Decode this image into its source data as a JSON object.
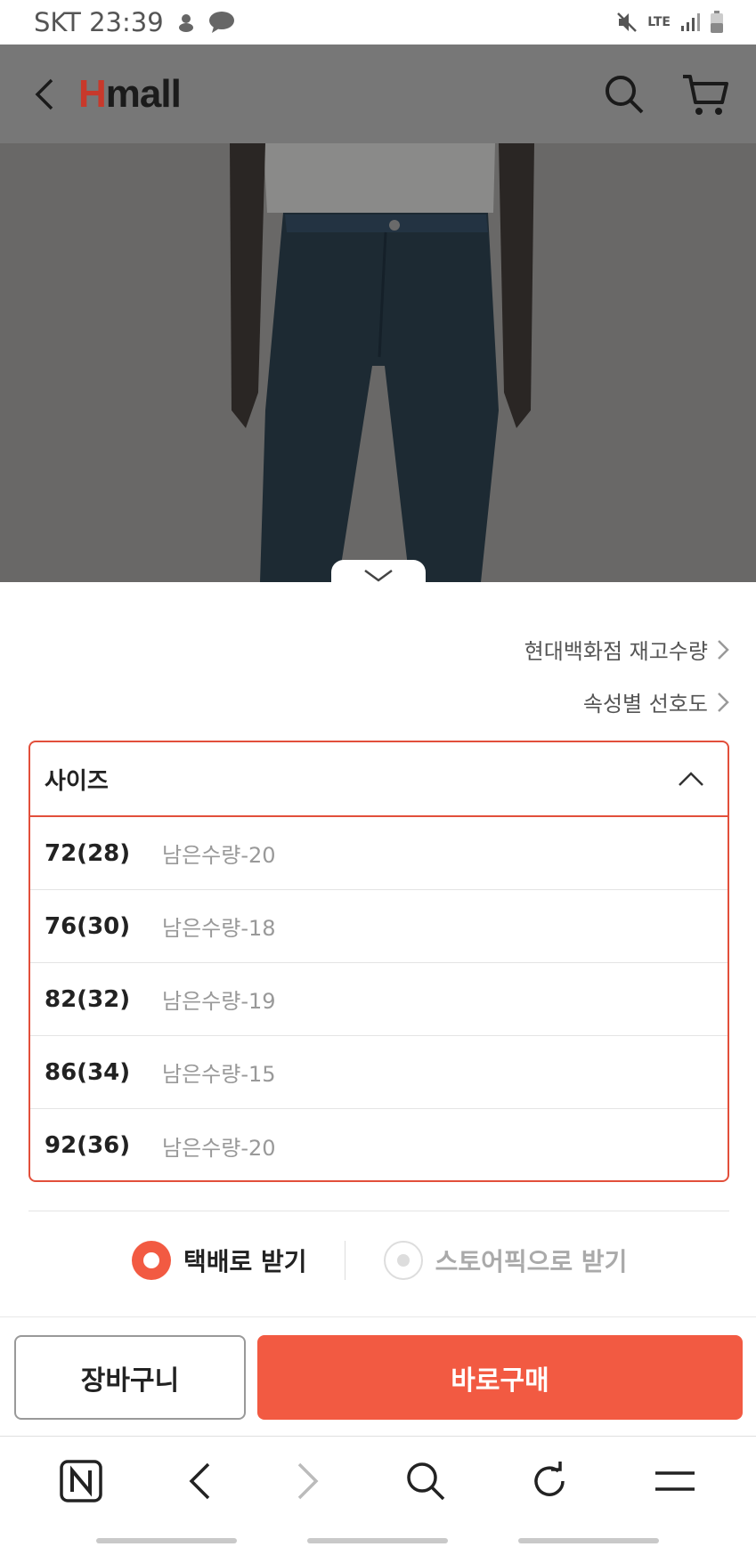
{
  "status_bar": {
    "carrier_time": "SKT 23:39",
    "network": "LTE"
  },
  "app_bar": {
    "logo_h": "H",
    "logo_rest": "mall"
  },
  "links": {
    "stock": "현대백화점 재고수량",
    "preference": "속성별 선호도"
  },
  "size_dropdown": {
    "label": "사이즈",
    "options": [
      {
        "size": "72(28)",
        "stock": "남은수량-20"
      },
      {
        "size": "76(30)",
        "stock": "남은수량-18"
      },
      {
        "size": "82(32)",
        "stock": "남은수량-19"
      },
      {
        "size": "86(34)",
        "stock": "남은수량-15"
      },
      {
        "size": "92(36)",
        "stock": "남은수량-20"
      }
    ]
  },
  "delivery": {
    "option1": "택배로 받기",
    "option2": "스토어픽으로 받기",
    "selected": "option1"
  },
  "actions": {
    "cart": "장바구니",
    "buy": "바로구매"
  },
  "colors": {
    "accent": "#f25a42",
    "border_accent": "#e24f3b",
    "logo_red": "#c8392b"
  },
  "browser_bar": {
    "icons": [
      "naver-n-icon",
      "back-icon",
      "forward-icon",
      "search-icon",
      "refresh-icon",
      "menu-icon"
    ]
  }
}
